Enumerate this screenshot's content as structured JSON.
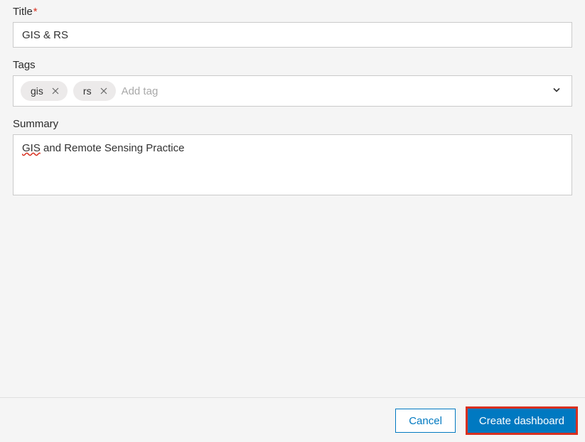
{
  "title_field": {
    "label": "Title",
    "required_mark": "*",
    "value": "GIS & RS"
  },
  "tags_field": {
    "label": "Tags",
    "tags": [
      {
        "text": "gis"
      },
      {
        "text": "rs"
      }
    ],
    "placeholder": "Add tag"
  },
  "summary_field": {
    "label": "Summary",
    "value_prefix": "GIS",
    "value_rest": " and Remote Sensing Practice"
  },
  "footer": {
    "cancel_label": "Cancel",
    "create_label": "Create dashboard"
  }
}
